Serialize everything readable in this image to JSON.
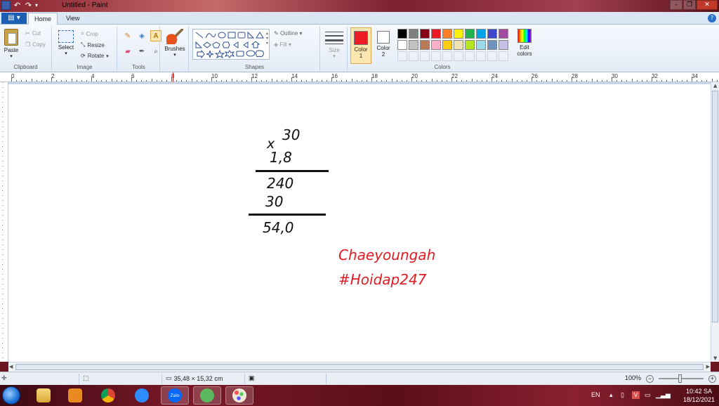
{
  "window": {
    "title": "Untitled - Paint",
    "buttons": {
      "minimize": "–",
      "maximize": "❐",
      "close": "✕"
    }
  },
  "ribbon": {
    "file_label": "▤ ▾",
    "tabs": [
      {
        "label": "Home"
      },
      {
        "label": "View"
      }
    ],
    "clipboard": {
      "paste": "Paste",
      "cut": "Cut",
      "copy": "Copy",
      "group": "Clipboard"
    },
    "image": {
      "select": "Select",
      "crop": "Crop",
      "resize": "Resize",
      "rotate": "Rotate",
      "group": "Image"
    },
    "tools": {
      "group": "Tools"
    },
    "brushes": {
      "label": "Brushes"
    },
    "shapes": {
      "outline": "Outline",
      "fill": "Fill",
      "group": "Shapes"
    },
    "size": {
      "label": "Size"
    },
    "colors": {
      "color1_label": "Color\n1",
      "color2_label": "Color\n2",
      "edit_colors": "Edit colors",
      "group": "Colors",
      "color1_value": "#ed1c24",
      "color2_value": "#ffffff",
      "palette": [
        "#000000",
        "#7f7f7f",
        "#880015",
        "#ed1c24",
        "#ff7f27",
        "#fff200",
        "#22b14c",
        "#00a2e8",
        "#3f48cc",
        "#a349a4",
        "#ffffff",
        "#c3c3c3",
        "#b97a57",
        "#ffaec9",
        "#ffc90e",
        "#efe4b0",
        "#b5e61d",
        "#99d9ea",
        "#7092be",
        "#c8bfe7"
      ]
    }
  },
  "ruler": {
    "labels": [
      "0",
      "2",
      "4",
      "6",
      "8",
      "10",
      "12",
      "14",
      "16",
      "18",
      "20",
      "22",
      "24",
      "26",
      "28",
      "30",
      "32",
      "34"
    ]
  },
  "canvas": {
    "lines": [
      {
        "text": "30"
      },
      {
        "text": "x"
      },
      {
        "text": "1,8"
      },
      {
        "text": "240"
      },
      {
        "text": "30"
      },
      {
        "text": "54,0"
      }
    ],
    "signature": [
      "Chaeyoungah",
      "#Hoidap247"
    ]
  },
  "status": {
    "dimensions": "35,48 × 15,32 cm",
    "zoom": "100%"
  },
  "taskbar": {
    "language": "EN",
    "time": "10:42 SA",
    "date": "18/12/2021",
    "zalo_label": "Zalo"
  }
}
